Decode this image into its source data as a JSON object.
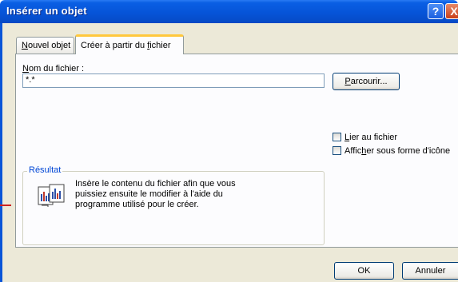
{
  "dialog": {
    "title": "Insérer un objet",
    "help_label": "?",
    "close_label": "X"
  },
  "tabs": [
    {
      "label_u": "N",
      "label_rest": "ouvel objet"
    },
    {
      "label_pre": "Créer à partir du ",
      "label_u": "f",
      "label_rest": "ichier"
    }
  ],
  "file": {
    "label_u": "N",
    "label_rest": "om du fichier :",
    "value": "*.*"
  },
  "browse": {
    "label_u": "P",
    "label_rest": "arcourir..."
  },
  "options": [
    {
      "label_u": "L",
      "label_rest": "ier au fichier",
      "checked": false
    },
    {
      "label_pre": "Affic",
      "label_u": "h",
      "label_rest": "er sous forme d'icône",
      "checked": false
    }
  ],
  "result": {
    "legend": "Résultat",
    "text_lines": [
      "Insère le contenu du fichier afin que vous",
      "puissiez ensuite le modifier à l'aide du",
      "programme utilisé pour le créer."
    ]
  },
  "buttons": {
    "ok": "OK",
    "cancel": "Annuler"
  }
}
